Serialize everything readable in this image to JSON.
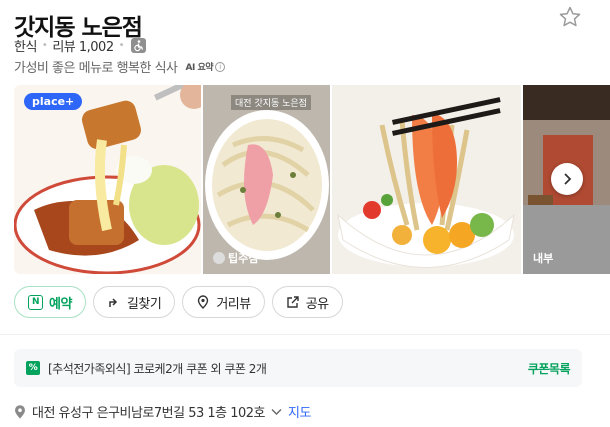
{
  "place": {
    "name": "갓지동 노은점",
    "category": "한식",
    "reviews": "리뷰 1,002",
    "description": "가성비 좋은 메뉴로 행복한 식사",
    "ai_label": "AI 요약",
    "ai_info": "i"
  },
  "photos": {
    "badge": "place+",
    "caption_top": "대전 갓지동 노은점",
    "caption_bottom": "팁주심",
    "interior_label": "내부"
  },
  "actions": [
    {
      "label": "예약",
      "icon": "naver-reserve-icon"
    },
    {
      "label": "길찾기",
      "icon": "directions-icon"
    },
    {
      "label": "거리뷰",
      "icon": "location-pin-icon"
    },
    {
      "label": "공유",
      "icon": "share-icon"
    }
  ],
  "reserve_icon_text": "N",
  "coupon": {
    "icon_text": "%",
    "text": "[추석전가족외식] 코로케2개 쿠폰 외 쿠폰 2개",
    "link": "쿠폰목록"
  },
  "address": {
    "text": "대전 유성구 은구비남로7번길 53 1층 102호",
    "map_link": "지도"
  },
  "colors": {
    "accent_green": "#04a35d",
    "badge_blue": "#2e67f7"
  }
}
